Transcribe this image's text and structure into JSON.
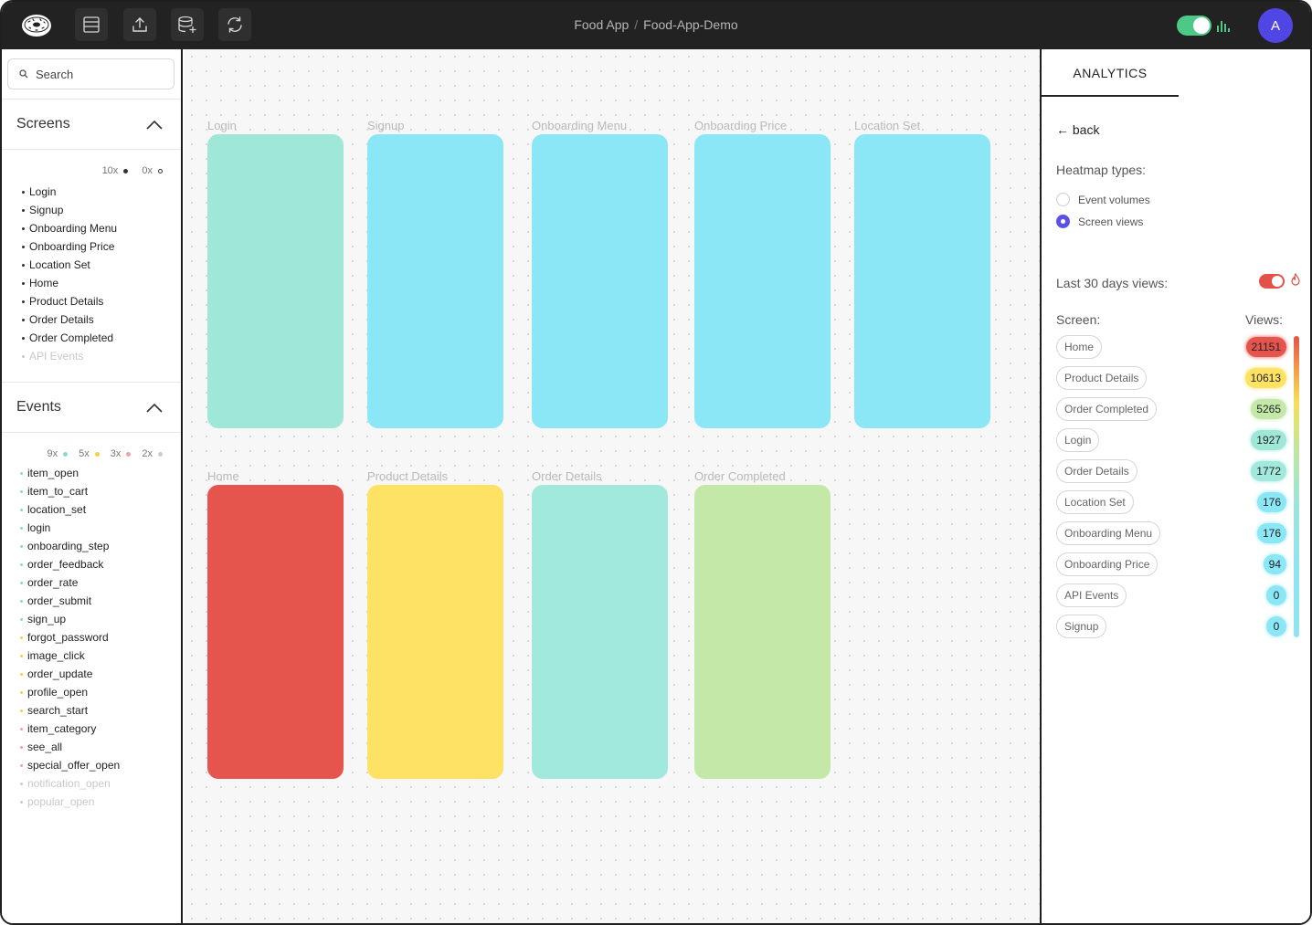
{
  "header": {
    "project": "Food App",
    "separator": "/",
    "version": "Food-App-Demo",
    "toggle_state": "on",
    "avatar_initial": "A",
    "tools": [
      "layout-icon",
      "upload-icon",
      "database-add-icon",
      "sync-icon"
    ]
  },
  "sidebar": {
    "search_placeholder": "Search",
    "screens": {
      "title": "Screens",
      "legend": [
        {
          "text": "10x",
          "color": "#333333",
          "style": "filled"
        },
        {
          "text": "0x",
          "color": "#333333",
          "style": "outline"
        }
      ],
      "items": [
        "Login",
        "Signup",
        "Onboarding Menu",
        "Onboarding Price",
        "Location Set",
        "Home",
        "Product Details",
        "Order Details",
        "Order Completed",
        "API Events"
      ]
    },
    "events": {
      "title": "Events",
      "legend": [
        {
          "text": "9x",
          "color": "#8fd8cf"
        },
        {
          "text": "5x",
          "color": "#f3d14b"
        },
        {
          "text": "3x",
          "color": "#f0a0a8"
        },
        {
          "text": "2x",
          "color": "#cccccc"
        }
      ],
      "items": [
        {
          "name": "item_open",
          "color": "#8fd8cf"
        },
        {
          "name": "item_to_cart",
          "color": "#8fd8cf"
        },
        {
          "name": "location_set",
          "color": "#8fd8cf"
        },
        {
          "name": "login",
          "color": "#8fd8cf"
        },
        {
          "name": "onboarding_step",
          "color": "#8fd8cf"
        },
        {
          "name": "order_feedback",
          "color": "#8fd8cf"
        },
        {
          "name": "order_rate",
          "color": "#8fd8cf"
        },
        {
          "name": "order_submit",
          "color": "#8fd8cf"
        },
        {
          "name": "sign_up",
          "color": "#8fd8cf"
        },
        {
          "name": "forgot_password",
          "color": "#f3d14b"
        },
        {
          "name": "image_click",
          "color": "#f3d14b"
        },
        {
          "name": "order_update",
          "color": "#f3d14b"
        },
        {
          "name": "profile_open",
          "color": "#f3d14b"
        },
        {
          "name": "search_start",
          "color": "#f3d14b"
        },
        {
          "name": "item_category",
          "color": "#f0a0a8"
        },
        {
          "name": "see_all",
          "color": "#f0a0a8"
        },
        {
          "name": "special_offer_open",
          "color": "#f0a0a8"
        },
        {
          "name": "notification_open",
          "color": "#cccccc"
        },
        {
          "name": "popular_open",
          "color": "#cccccc"
        }
      ]
    }
  },
  "canvas": {
    "row1": [
      {
        "label": "Login",
        "color": "#9fe8d8"
      },
      {
        "label": "Signup",
        "color": "#8be6f5"
      },
      {
        "label": "Onboarding Menu",
        "color": "#8be6f5"
      },
      {
        "label": "Onboarding Price",
        "color": "#8be6f5"
      },
      {
        "label": "Location Set",
        "color": "#8be6f5"
      }
    ],
    "row2": [
      {
        "label": "Home",
        "color": "#e5554e"
      },
      {
        "label": "Product Details",
        "color": "#fde264"
      },
      {
        "label": "Order Details",
        "color": "#a1e8dd"
      },
      {
        "label": "Order Completed",
        "color": "#c3e8a8"
      }
    ]
  },
  "analytics": {
    "tab": "ANALYTICS",
    "back": "← back",
    "heatmap_label": "Heatmap types:",
    "heatmap_types": [
      {
        "label": "Event volumes",
        "selected": false
      },
      {
        "label": "Screen views",
        "selected": true
      }
    ],
    "last30_label": "Last 30 days views:",
    "last30_toggle": "on",
    "screen_col": "Screen:",
    "views_col": "Views:",
    "rows": [
      {
        "screen": "Home",
        "views": "21151",
        "color": "#e5554e"
      },
      {
        "screen": "Product Details",
        "views": "10613",
        "color": "#fde264"
      },
      {
        "screen": "Order Completed",
        "views": "5265",
        "color": "#c3e8a8"
      },
      {
        "screen": "Login",
        "views": "1927",
        "color": "#9fe8d8"
      },
      {
        "screen": "Order Details",
        "views": "1772",
        "color": "#a1e8dd"
      },
      {
        "screen": "Location Set",
        "views": "176",
        "color": "#8be6f5"
      },
      {
        "screen": "Onboarding Menu",
        "views": "176",
        "color": "#8be6f5"
      },
      {
        "screen": "Onboarding Price",
        "views": "94",
        "color": "#8be6f5"
      },
      {
        "screen": "API Events",
        "views": "0",
        "color": "#8be6f5"
      },
      {
        "screen": "Signup",
        "views": "0",
        "color": "#8be6f5"
      }
    ]
  }
}
